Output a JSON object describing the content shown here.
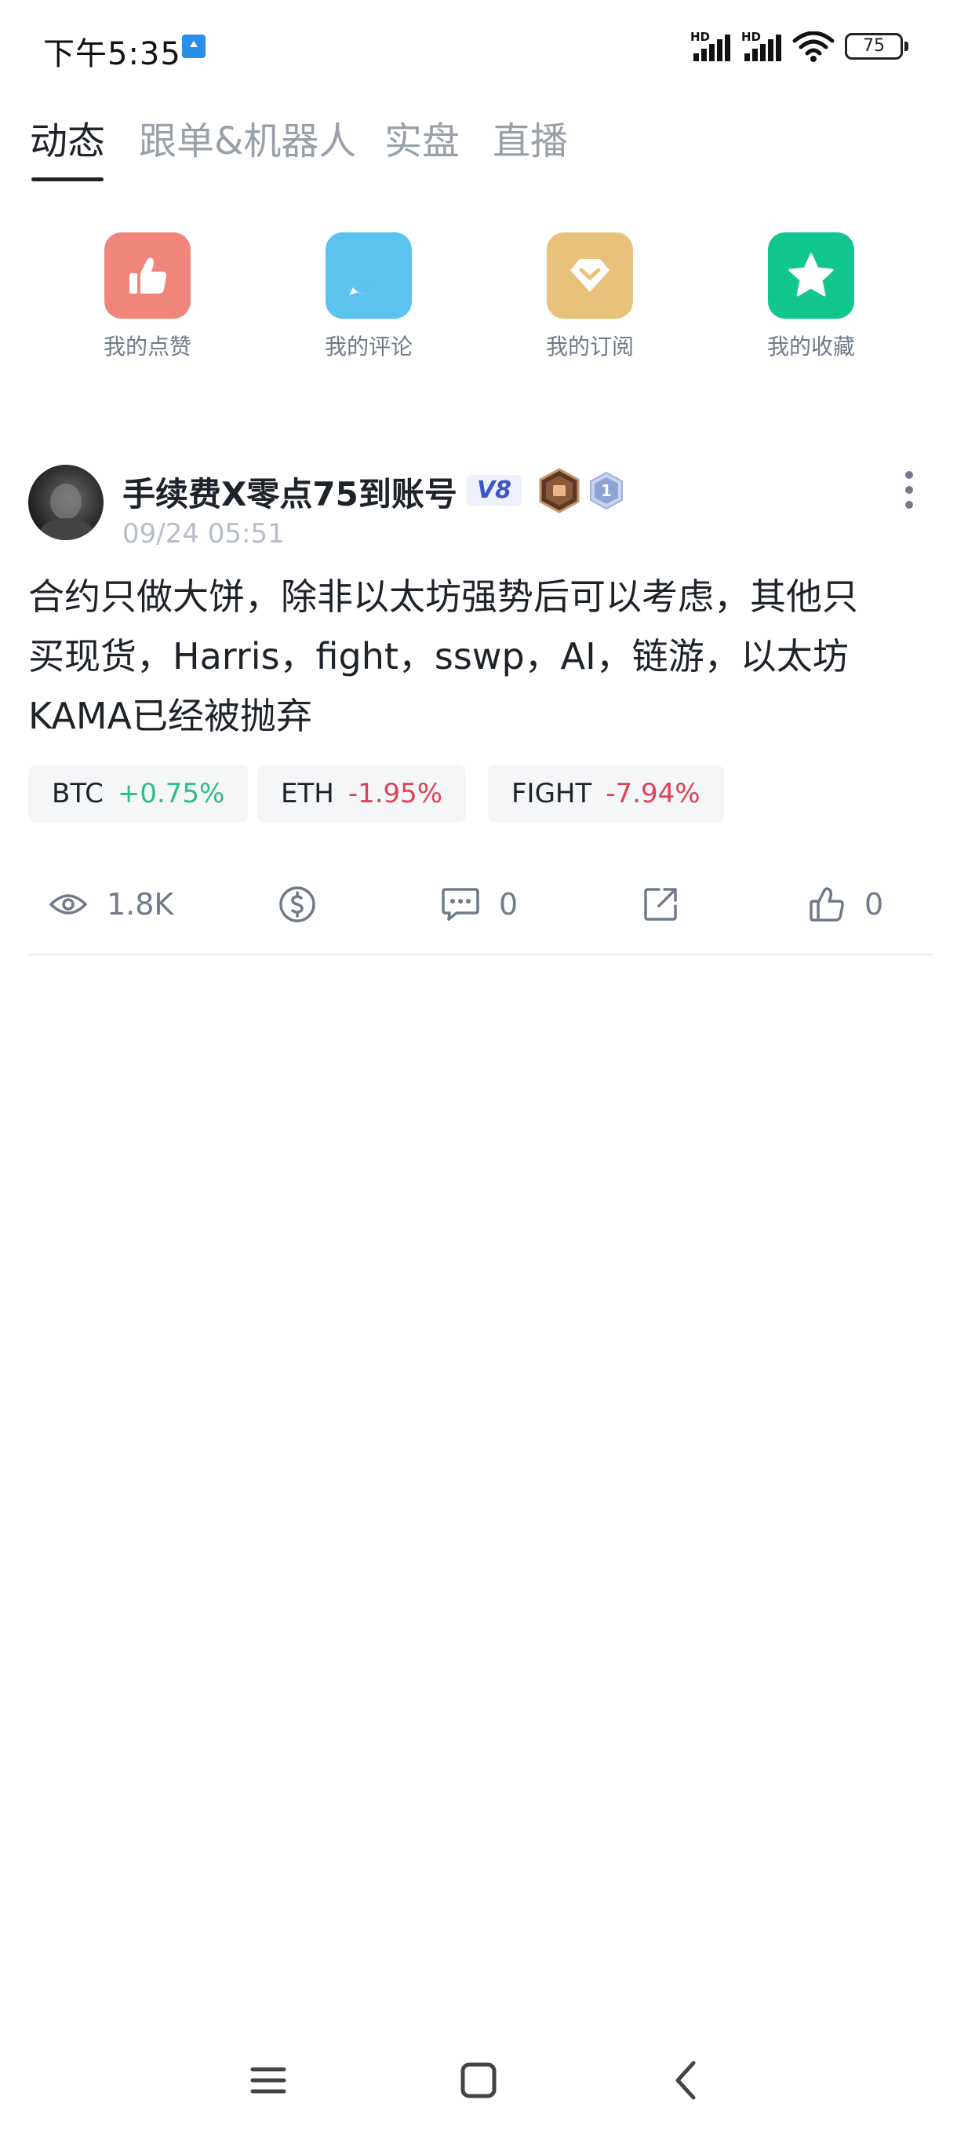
{
  "status_bar": {
    "time": "下午5:35",
    "signal_label_1": "HD",
    "signal_label_2": "HD",
    "battery": "75"
  },
  "tabs": [
    {
      "label": "动态",
      "active": true
    },
    {
      "label": "跟单&机器人",
      "active": false
    },
    {
      "label": "实盘",
      "active": false
    },
    {
      "label": "直播",
      "active": false
    }
  ],
  "shortcuts": [
    {
      "label": "我的点赞",
      "icon": "thumbs-up-icon",
      "color": "#f0857c"
    },
    {
      "label": "我的评论",
      "icon": "comment-icon",
      "color": "#5bc3ee"
    },
    {
      "label": "我的订阅",
      "icon": "diamond-icon",
      "color": "#e8c27a"
    },
    {
      "label": "我的收藏",
      "icon": "star-icon",
      "color": "#12c68f"
    }
  ],
  "post": {
    "author": "手续费X零点75到账号",
    "vip_level": "V8",
    "rank_level": "1",
    "time": "09/24 05:51",
    "content": "合约只做大饼，除非以太坊强势后可以考虑，其他只\n买现货，Harris，fight，sswp，AI，链游，以太坊\nKAMA已经被抛弃",
    "coins": [
      {
        "symbol": "BTC",
        "change": "+0.75%",
        "direction": "up"
      },
      {
        "symbol": "ETH",
        "change": "-1.95%",
        "direction": "down"
      },
      {
        "symbol": "FIGHT",
        "change": "-7.94%",
        "direction": "down"
      }
    ],
    "stats": {
      "views": "1.8K",
      "comments": "0",
      "likes": "0"
    }
  },
  "colors": {
    "text_primary": "#1e2329",
    "text_secondary": "#707a8a",
    "up": "#2ebd85",
    "down": "#e04157"
  },
  "nav": {
    "menu_icon": "menu-icon",
    "home_icon": "home-square-icon",
    "back_icon": "back-chevron-icon"
  }
}
